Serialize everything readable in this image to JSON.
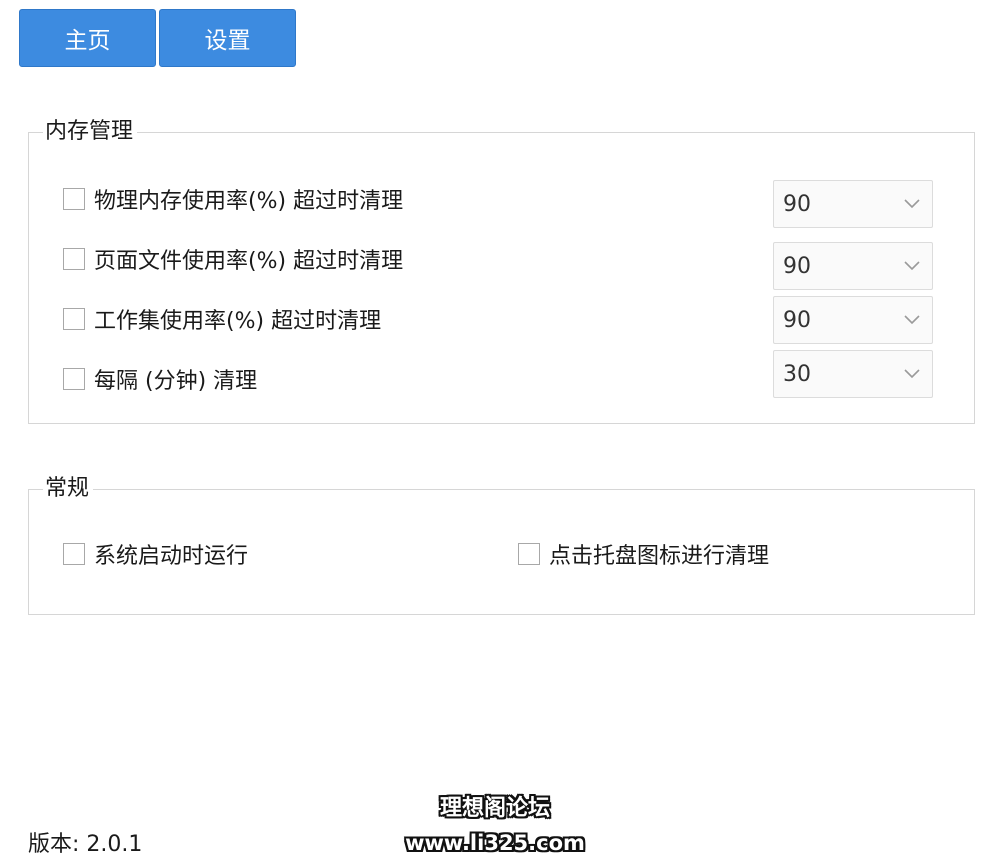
{
  "tabs": {
    "home_label": "主页",
    "settings_label": "设置"
  },
  "memory_group": {
    "title": "内存管理",
    "options": [
      {
        "label": "物理内存使用率(%) 超过时清理",
        "value": "90",
        "checked": false
      },
      {
        "label": "页面文件使用率(%) 超过时清理",
        "value": "90",
        "checked": false
      },
      {
        "label": "工作集使用率(%) 超过时清理",
        "value": "90",
        "checked": false
      },
      {
        "label": "每隔 (分钟) 清理",
        "value": "30",
        "checked": false
      }
    ]
  },
  "general_group": {
    "title": "常规",
    "options": [
      {
        "label": "系统启动时运行",
        "checked": false
      },
      {
        "label": "点击托盘图标进行清理",
        "checked": false
      }
    ]
  },
  "footer": {
    "version": "版本: 2.0.1"
  },
  "watermark": {
    "name": "理想阁论坛",
    "url": "www.li325.com"
  },
  "icons": {
    "select_arrow": "chevron-down-icon"
  },
  "colors": {
    "accent": "#3d8be0",
    "border": "#d6d6d6"
  }
}
